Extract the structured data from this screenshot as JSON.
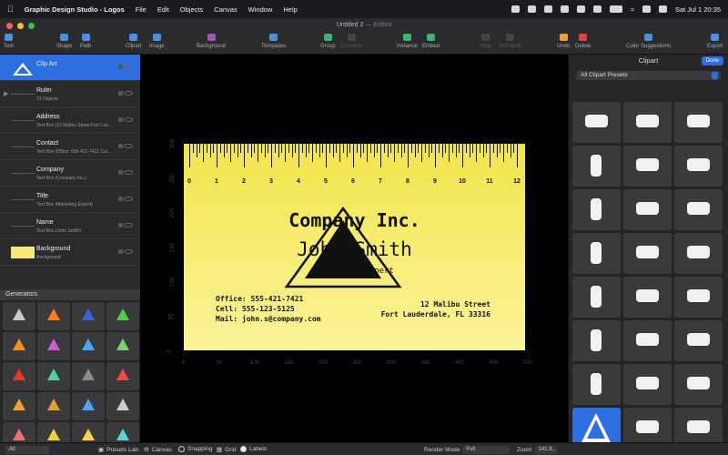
{
  "menubar": {
    "app_name": "Graphic Design Studio - Logos",
    "menus": [
      "File",
      "Edit",
      "Objects",
      "Canvas",
      "Window",
      "Help"
    ],
    "clock": "Sat Jul 1  20:35"
  },
  "window": {
    "title": "Untitled 2",
    "status": "— Edited"
  },
  "toolbar": {
    "tools": [
      {
        "label": "Text",
        "icon": "text-icon",
        "disabled": false
      },
      {
        "label": "Shape",
        "icon": "shape-icon",
        "disabled": false
      },
      {
        "label": "Path",
        "icon": "path-icon",
        "disabled": false
      },
      {
        "label": "Clipart",
        "icon": "clipart-icon",
        "disabled": false
      },
      {
        "label": "Image",
        "icon": "image-icon",
        "disabled": false
      },
      {
        "label": "Background",
        "icon": "background-icon",
        "disabled": false
      },
      {
        "label": "Templates",
        "icon": "templates-icon",
        "disabled": false
      },
      {
        "label": "Group",
        "icon": "group-icon",
        "disabled": false
      },
      {
        "label": "Combine",
        "icon": "combine-icon",
        "disabled": true
      },
      {
        "label": "Instance",
        "icon": "instance-icon",
        "disabled": false
      },
      {
        "label": "Embed",
        "icon": "embed-icon",
        "disabled": false
      },
      {
        "label": "Align",
        "icon": "align-icon",
        "disabled": true
      },
      {
        "label": "Distribute",
        "icon": "distribute-icon",
        "disabled": true
      },
      {
        "label": "Undo",
        "icon": "undo-icon",
        "disabled": false
      },
      {
        "label": "Delete",
        "icon": "delete-icon",
        "disabled": false
      },
      {
        "label": "Color Suggestions",
        "icon": "color-suggestions-icon",
        "disabled": false
      },
      {
        "label": "Export",
        "icon": "export-icon",
        "disabled": false
      }
    ]
  },
  "layers": [
    {
      "name": "Clip Art",
      "sub": "",
      "selected": true,
      "thumb": "clipart"
    },
    {
      "name": "Ruler",
      "sub": "13 Objects",
      "selected": false,
      "thumb": "line"
    },
    {
      "name": "Address",
      "sub": "Text Box (12 Malibu Street Fort Lau...",
      "selected": false,
      "thumb": "line"
    },
    {
      "name": "Contact",
      "sub": "Text Box (Office: 555-421-7421 Cel...",
      "selected": false,
      "thumb": "line"
    },
    {
      "name": "Company",
      "sub": "Text Box (Company Inc.)",
      "selected": false,
      "thumb": "line"
    },
    {
      "name": "Title",
      "sub": "Text Box (Marketing Expert)",
      "selected": false,
      "thumb": "line"
    },
    {
      "name": "Name",
      "sub": "Text Box (John Smith)",
      "selected": false,
      "thumb": "line"
    },
    {
      "name": "Background",
      "sub": "Background",
      "selected": false,
      "thumb": "yellow"
    }
  ],
  "generators": {
    "title": "Generators",
    "colors": [
      "#c9c9c9",
      "#ff7a1a",
      "#3d62d6",
      "#4ccf4c",
      "#ff8c1a",
      "#c95bd6",
      "#4aa6f0",
      "#7bd36a",
      "#e23a2a",
      "#4fd0a3",
      "#8a8a8a",
      "#f04848",
      "#f0a030",
      "#e0a030",
      "#4aa6f0",
      "#cfcfcf",
      "#f07070",
      "#f0d040",
      "#ffcf50",
      "#60d0d0"
    ]
  },
  "canvas": {
    "card": {
      "company": "Company Inc.",
      "name": "John Smith",
      "title": "Marketing Expert",
      "contact": [
        "Office: 555-421-7421",
        "Cell: 555-123-5125",
        "Mail: john.s@company.com"
      ],
      "address": [
        "12 Malibu Street",
        "Fort Lauderdale, FL 33316"
      ]
    },
    "ruler_numbers": [
      "0",
      "1",
      "2",
      "3",
      "4",
      "5",
      "6",
      "7",
      "8",
      "9",
      "10",
      "11",
      "12"
    ],
    "x_axis": [
      "0",
      "50",
      "100",
      "150",
      "200",
      "250",
      "300",
      "350",
      "400",
      "450",
      "500"
    ],
    "y_axis": [
      "300",
      "250",
      "200",
      "150",
      "100",
      "50",
      "0"
    ]
  },
  "clipart": {
    "title": "Clipart",
    "done_label": "Done",
    "preset": "All Clipart Presets",
    "items": 24
  },
  "status": {
    "filter": "All",
    "presets_lab": "Presets Lab",
    "canvas": "Canvas",
    "snapping": "Snapping",
    "grid": "Grid",
    "labels": "Labels",
    "render_mode_label": "Render Mode",
    "render_mode": "Full",
    "zoom_label": "Zoom",
    "zoom": "141.9..."
  }
}
